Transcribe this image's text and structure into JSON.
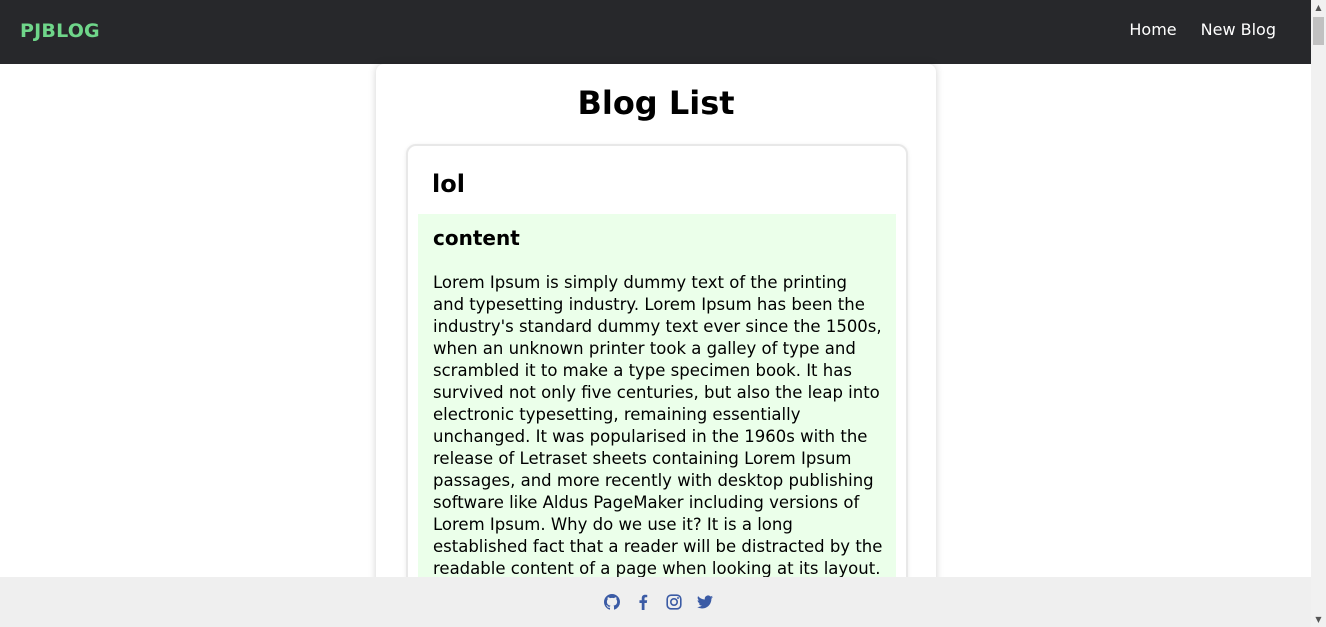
{
  "header": {
    "brand": "PJBLOG",
    "nav": [
      {
        "label": "Home"
      },
      {
        "label": "New Blog"
      }
    ]
  },
  "main": {
    "title": "Blog List",
    "blogs": [
      {
        "title": "lol",
        "content_heading": "content",
        "content_text": "Lorem Ipsum is simply dummy text of the printing and typesetting industry. Lorem Ipsum has been the industry's standard dummy text ever since the 1500s, when an unknown printer took a galley of type and scrambled it to make a type specimen book. It has survived not only five centuries, but also the leap into electronic typesetting, remaining essentially unchanged. It was popularised in the 1960s with the release of Letraset sheets containing Lorem Ipsum passages, and more recently with desktop publishing software like Aldus PageMaker including versions of Lorem Ipsum. Why do we use it? It is a long established fact that a reader will be distracted by the readable content of a page when looking at its layout. The point of using"
      }
    ]
  },
  "footer": {
    "social": [
      {
        "icon": "github-icon"
      },
      {
        "icon": "facebook-icon"
      },
      {
        "icon": "instagram-icon"
      },
      {
        "icon": "twitter-icon"
      }
    ]
  },
  "colors": {
    "navbar_bg": "#27282b",
    "brand": "#6fd68a",
    "content_bg": "#ebffea",
    "footer_bg": "#efefef",
    "icon_blue": "#3b5ba5"
  }
}
